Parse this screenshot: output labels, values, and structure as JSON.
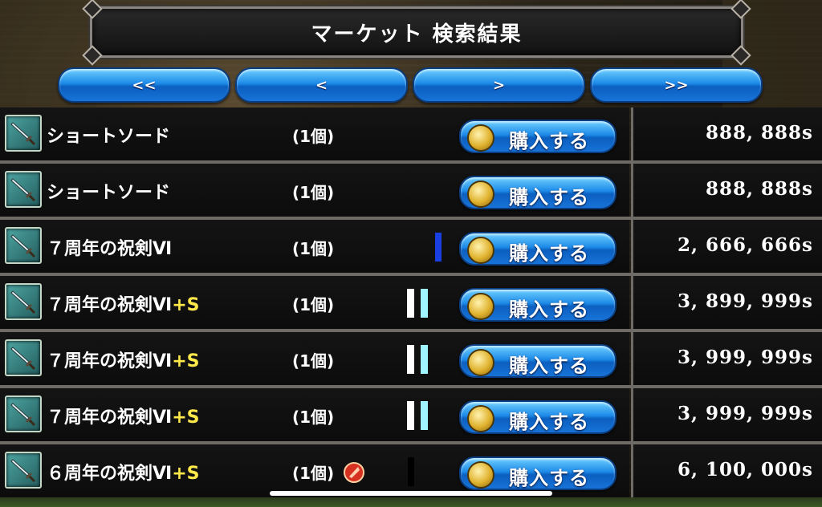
{
  "title": "マーケット 検索結果",
  "nav": {
    "first": "<<",
    "prev": "<",
    "next": ">",
    "last": ">>"
  },
  "buy_label": "購入する",
  "items": [
    {
      "name": "ショートソード",
      "suffix": "",
      "count": "(1個)",
      "price": "888, 888s",
      "marker": "none"
    },
    {
      "name": "ショートソード",
      "suffix": "",
      "count": "(1個)",
      "price": "888, 888s",
      "marker": "none"
    },
    {
      "name": "７周年の祝剣Ⅵ",
      "suffix": "",
      "count": "(1個)",
      "price": "2, 666, 666s",
      "marker": "blue"
    },
    {
      "name": "７周年の祝剣Ⅵ",
      "suffix": "+S",
      "count": "(1個)",
      "price": "3, 899, 999s",
      "marker": "white-cyan"
    },
    {
      "name": "７周年の祝剣Ⅵ",
      "suffix": "+S",
      "count": "(1個)",
      "price": "3, 999, 999s",
      "marker": "white-cyan"
    },
    {
      "name": "７周年の祝剣Ⅵ",
      "suffix": "+S",
      "count": "(1個)",
      "price": "3, 999, 999s",
      "marker": "white-cyan"
    },
    {
      "name": "６周年の祝剣Ⅵ",
      "suffix": "+S",
      "count": "(1個)",
      "price": "6, 100, 000s",
      "marker": "black"
    }
  ],
  "colors": {
    "button_blue": "#1d8ae8",
    "plus_yellow": "#ffe94a",
    "marker_blue": "#1a3fe0",
    "marker_cyan": "#9ff4ff"
  },
  "icons": {
    "item": "sword-icon",
    "buy": "coin-icon",
    "special": "red-crest-icon"
  }
}
